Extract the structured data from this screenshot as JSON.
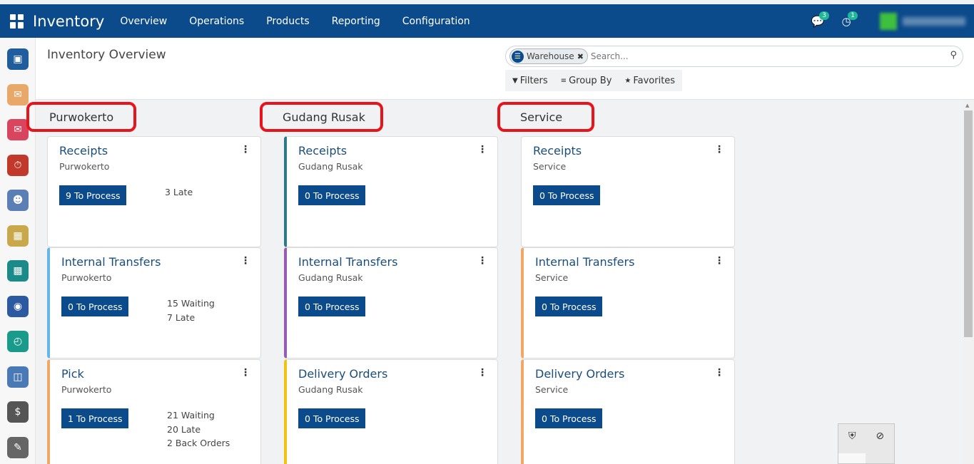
{
  "topbar": {
    "brand": "Inventory",
    "menu": [
      "Overview",
      "Operations",
      "Products",
      "Reporting",
      "Configuration"
    ],
    "messages_count": "3",
    "activities_count": "1"
  },
  "page": {
    "title": "Inventory Overview"
  },
  "search": {
    "facet_label": "Warehouse",
    "placeholder": "Search...",
    "filters_label": "Filters",
    "groupby_label": "Group By",
    "favorites_label": "Favorites"
  },
  "groups": [
    {
      "name": "Purwokerto",
      "cards": [
        {
          "title": "Receipts",
          "warehouse": "Purwokerto",
          "button": "9 To Process",
          "stats": [
            "3 Late"
          ],
          "color": ""
        },
        {
          "title": "Internal Transfers",
          "warehouse": "Purwokerto",
          "button": "0 To Process",
          "stats": [
            "15 Waiting",
            "7 Late"
          ],
          "color": "#64b5e8"
        },
        {
          "title": "Pick",
          "warehouse": "Purwokerto",
          "button": "1 To Process",
          "stats": [
            "21 Waiting",
            "20 Late",
            "2 Back Orders"
          ],
          "color": "#f0a868"
        }
      ]
    },
    {
      "name": "Gudang Rusak",
      "cards": [
        {
          "title": "Receipts",
          "warehouse": "Gudang Rusak",
          "button": "0 To Process",
          "stats": [],
          "color": "#2c7a8a"
        },
        {
          "title": "Internal Transfers",
          "warehouse": "Gudang Rusak",
          "button": "0 To Process",
          "stats": [],
          "color": "#9b59b6"
        },
        {
          "title": "Delivery Orders",
          "warehouse": "Gudang Rusak",
          "button": "0 To Process",
          "stats": [],
          "color": "#f1c40f"
        }
      ]
    },
    {
      "name": "Service",
      "cards": [
        {
          "title": "Receipts",
          "warehouse": "Service",
          "button": "0 To Process",
          "stats": [],
          "color": ""
        },
        {
          "title": "Internal Transfers",
          "warehouse": "Service",
          "button": "0 To Process",
          "stats": [],
          "color": "#f0a868"
        },
        {
          "title": "Delivery Orders",
          "warehouse": "Service",
          "button": "0 To Process",
          "stats": [],
          "color": "#f0a868"
        }
      ]
    }
  ],
  "sidebar_apps": [
    {
      "icon": "discuss-icon",
      "color": "#1f5d9c"
    },
    {
      "icon": "inbox-icon",
      "color": "#e8a86a"
    },
    {
      "icon": "chat-icon",
      "color": "#d9455f"
    },
    {
      "icon": "timer-icon",
      "color": "#c0392b"
    },
    {
      "icon": "employee-icon",
      "color": "#5b7fb5"
    },
    {
      "icon": "calendar-icon",
      "color": "#c9a84c"
    },
    {
      "icon": "dashboard-icon",
      "color": "#1a8a8a"
    },
    {
      "icon": "company-logo-icon",
      "color": "#2c5aa0"
    },
    {
      "icon": "clock-icon",
      "color": "#1a9a8a"
    },
    {
      "icon": "inventory-icon",
      "color": "#4a7ab5"
    },
    {
      "icon": "payroll-icon",
      "color": "#555555"
    },
    {
      "icon": "notes-icon",
      "color": "#666666"
    }
  ]
}
